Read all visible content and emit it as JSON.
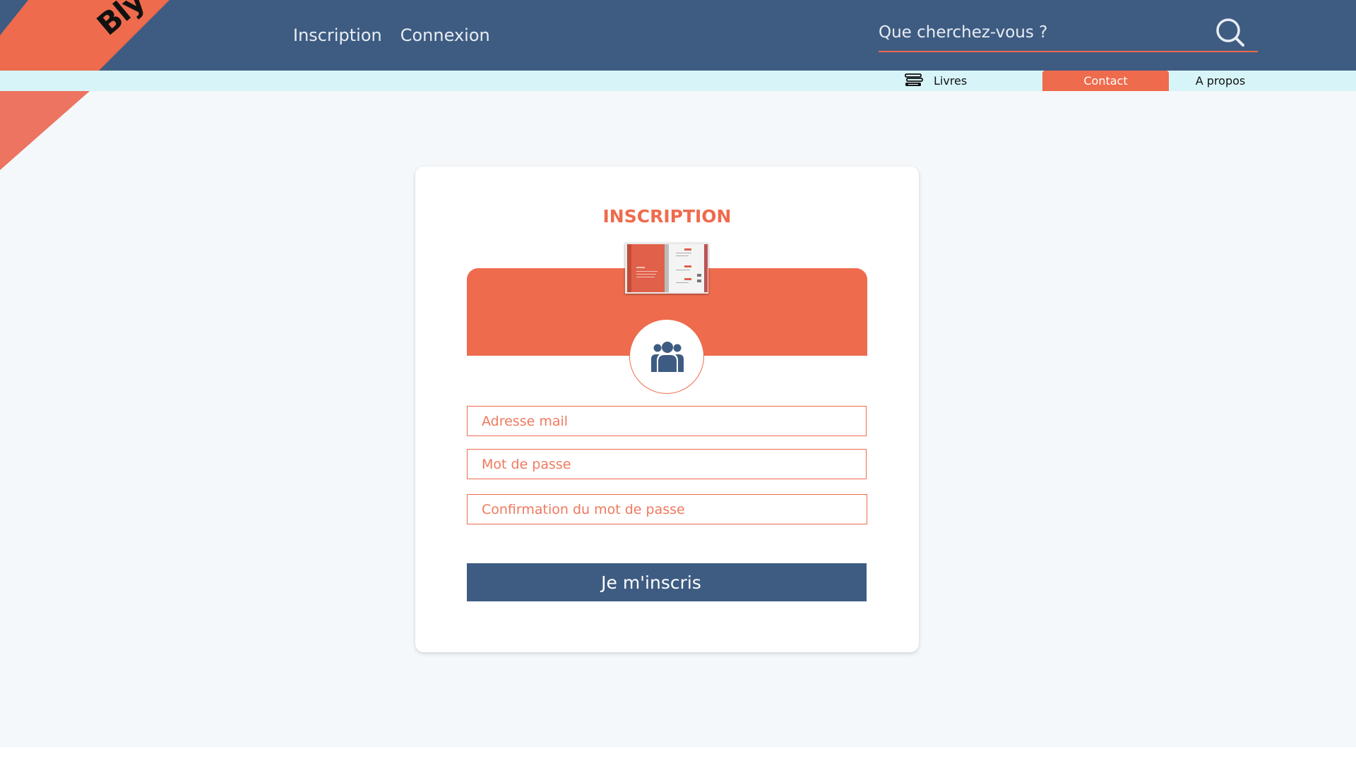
{
  "brand": {
    "logo_text": "Bly",
    "accent_color": "#ee6b4d",
    "header_color": "#3e5c82"
  },
  "header": {
    "nav": [
      {
        "label": "Inscription"
      },
      {
        "label": "Connexion"
      }
    ],
    "search": {
      "placeholder": "Que cherchez-vous ?",
      "icon": "search-icon"
    }
  },
  "subnav": {
    "livres": {
      "label": "Livres",
      "icon": "books-icon"
    },
    "contact": {
      "label": "Contact",
      "active": true
    },
    "apropos": {
      "label": "A propos"
    }
  },
  "form": {
    "title": "INSCRIPTION",
    "avatar_icon": "users-group-icon",
    "email_placeholder": "Adresse mail",
    "password_placeholder": "Mot de passe",
    "confirm_placeholder": "Confirmation du mot de passe",
    "submit_label": "Je m'inscris"
  }
}
